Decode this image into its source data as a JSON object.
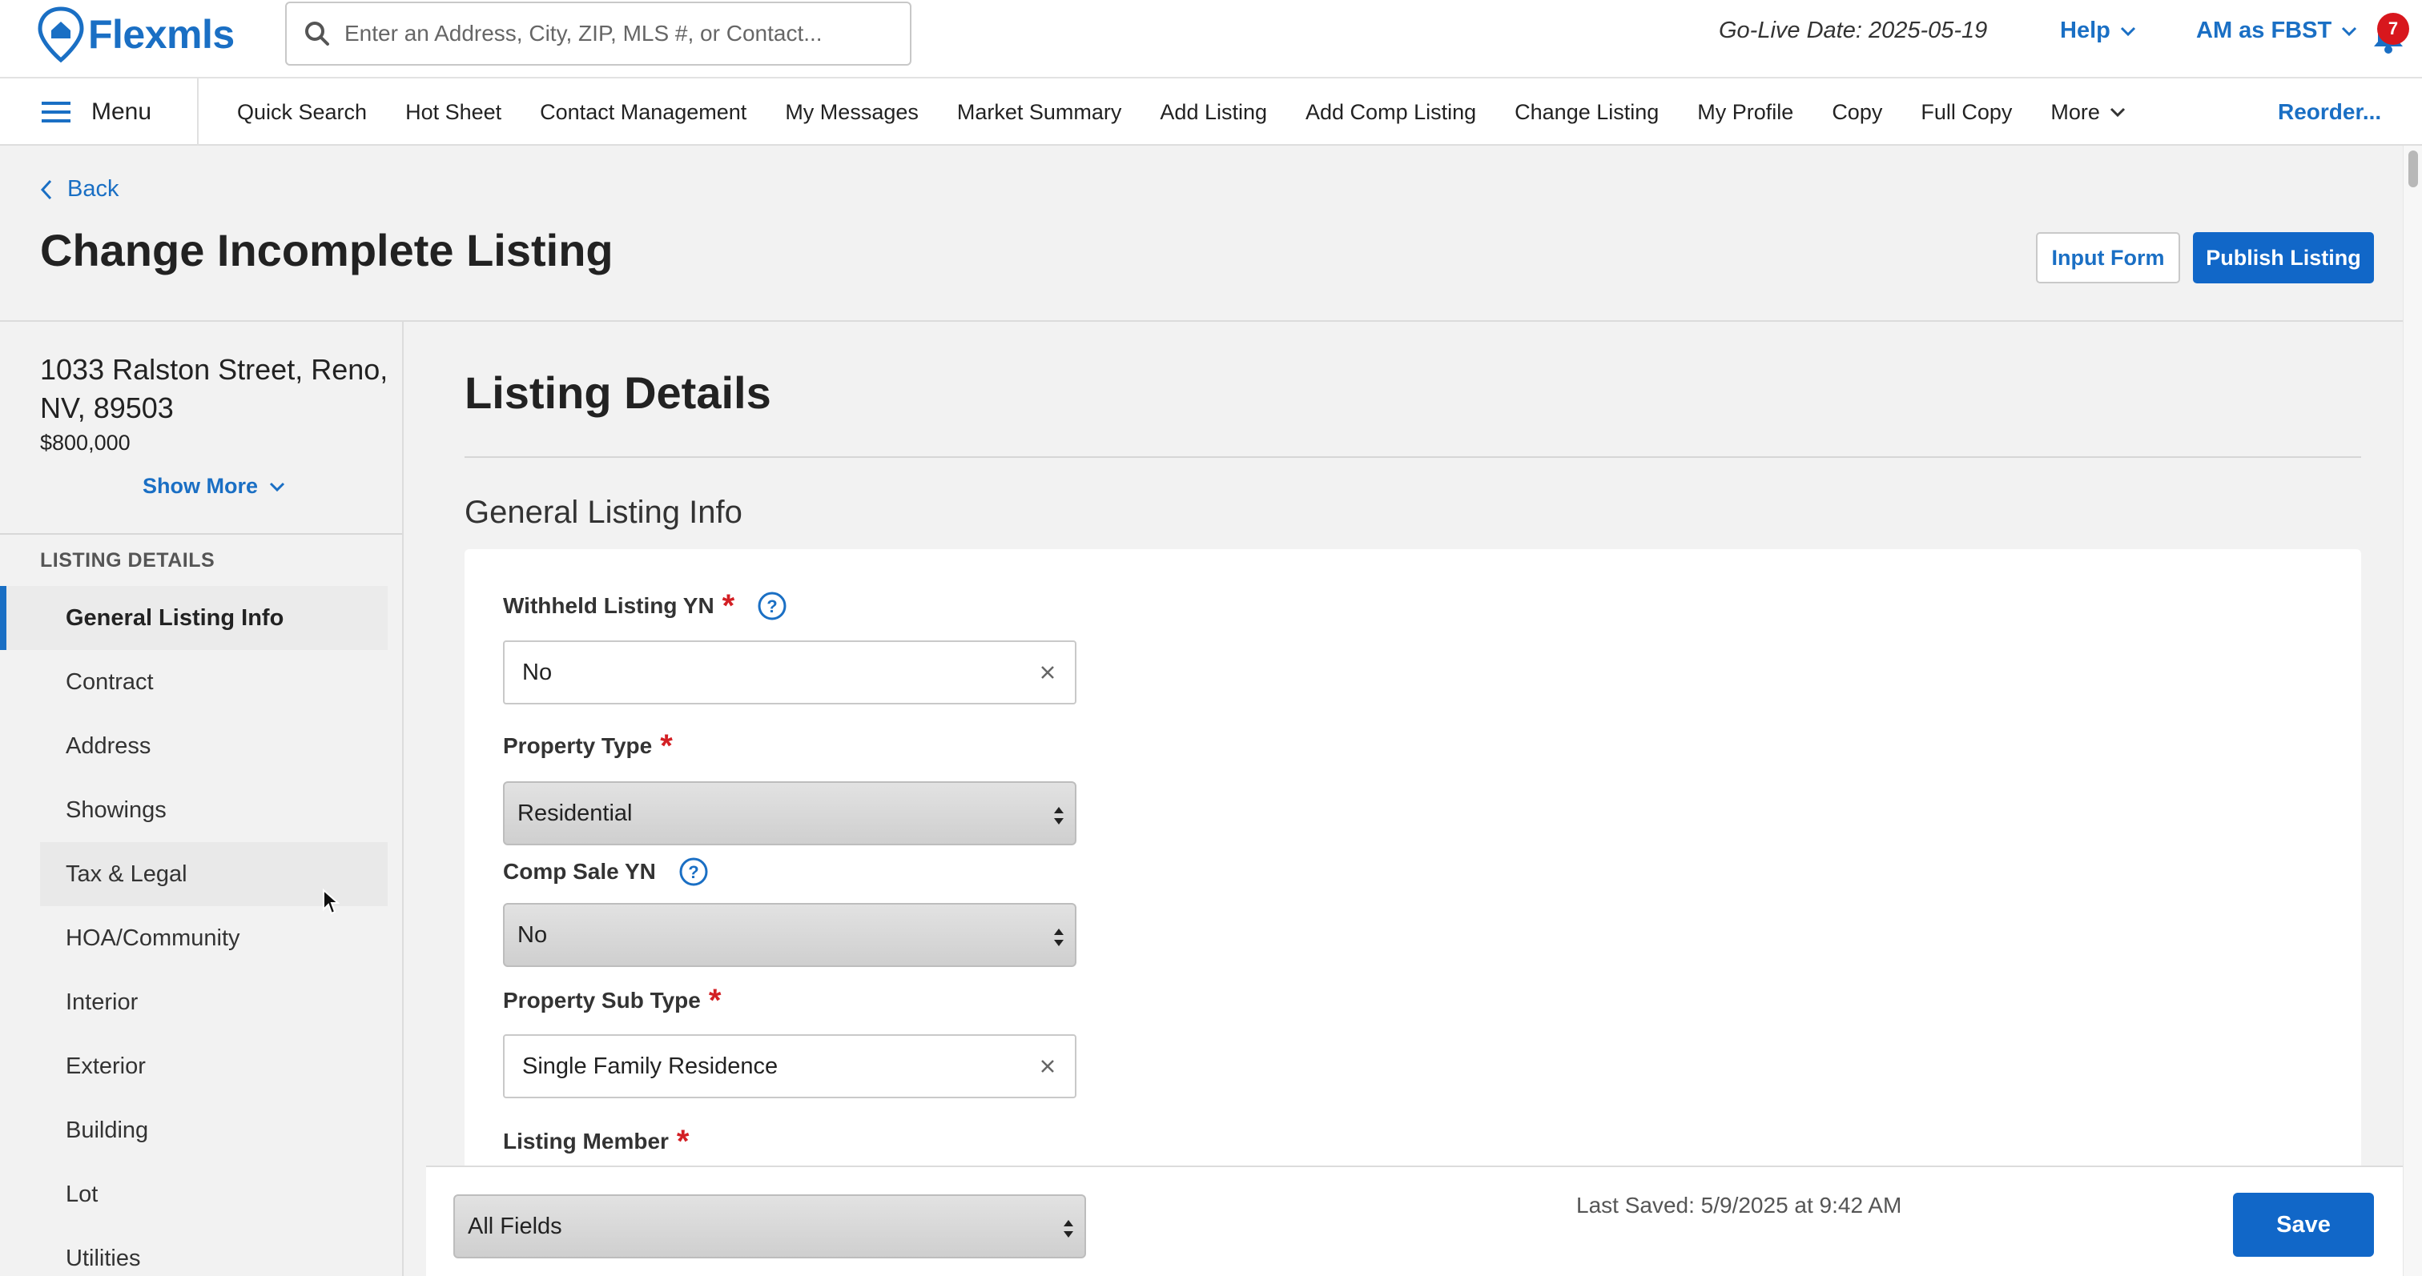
{
  "app": {
    "logo_text": "Flexmls",
    "search_placeholder": "Enter an Address, City, ZIP, MLS #, or Contact...",
    "golive": "Go-Live Date: 2025-05-19",
    "help_label": "Help",
    "account_label": "AM as FBST",
    "notifications_count": "7",
    "accent_color": "#1a6fc4",
    "badge_color": "#d8171d"
  },
  "nav": {
    "menu_label": "Menu",
    "items": [
      "Quick Search",
      "Hot Sheet",
      "Contact Management",
      "My Messages",
      "Market Summary",
      "Add Listing",
      "Add Comp Listing",
      "Change Listing",
      "My Profile",
      "Copy",
      "Full Copy"
    ],
    "more_label": "More",
    "reorder_label": "Reorder..."
  },
  "header": {
    "back_label": "Back",
    "title": "Change Incomplete Listing",
    "input_form_label": "Input Form",
    "publish_label": "Publish Listing"
  },
  "sidebar": {
    "address": "1033 Ralston Street, Reno, NV, 89503",
    "price": "$800,000",
    "show_more_label": "Show More",
    "section_header": "LISTING DETAILS",
    "items": [
      "General Listing Info",
      "Contract",
      "Address",
      "Showings",
      "Tax & Legal",
      "HOA/Community",
      "Interior",
      "Exterior",
      "Building",
      "Lot",
      "Utilities"
    ],
    "active_item": "General Listing Info",
    "hovered_item": "Tax & Legal"
  },
  "main": {
    "section_title": "Listing Details",
    "subsection_title": "General Listing Info",
    "fields": {
      "withheld_label": "Withheld Listing YN",
      "withheld_value": "No",
      "property_type_label": "Property Type",
      "property_type_value": "Residential",
      "comp_sale_label": "Comp Sale YN",
      "comp_sale_value": "No",
      "property_sub_type_label": "Property Sub Type",
      "property_sub_type_value": "Single Family Residence",
      "listing_member_label": "Listing Member",
      "required_mark": "*"
    }
  },
  "footer": {
    "view_value": "All Fields",
    "last_saved": "Last Saved: 5/9/2025 at 9:42 AM",
    "save_label": "Save"
  }
}
